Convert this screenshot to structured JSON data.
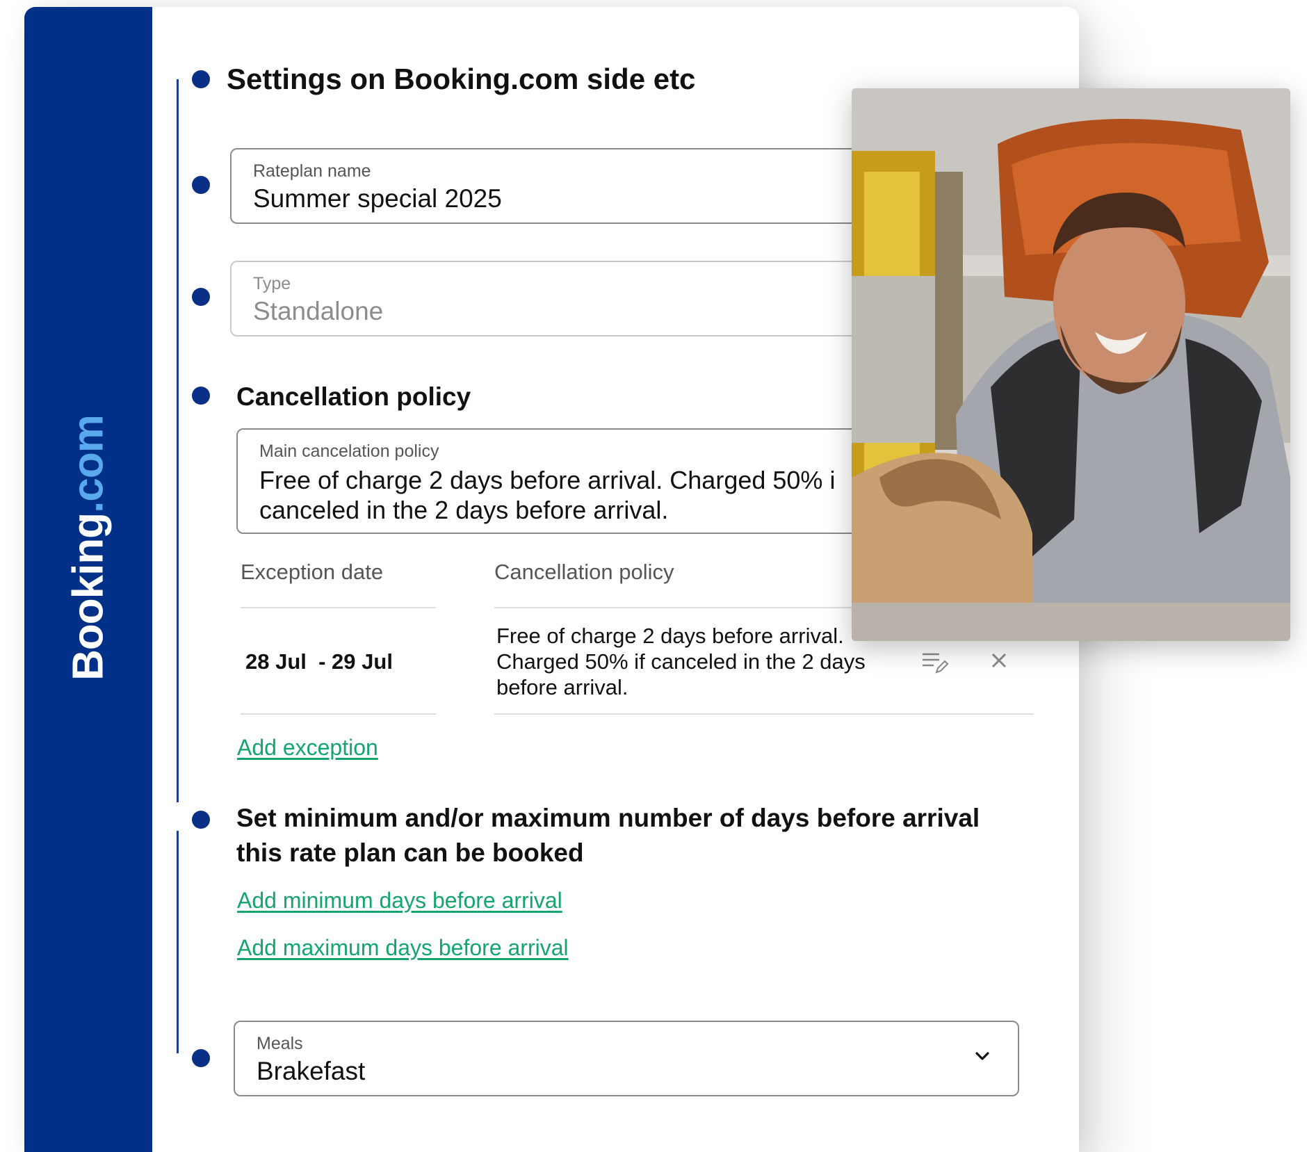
{
  "brand": {
    "part1": "Booking",
    "part2": ".com"
  },
  "section_title": "Settings on Booking.com side etc",
  "rateplan": {
    "label": "Rateplan name",
    "value": "Summer special 2025"
  },
  "type": {
    "label": "Type",
    "value": "Standalone"
  },
  "cancellation": {
    "heading": "Cancellation policy",
    "main_label": "Main cancelation policy",
    "main_line1": "Free of charge 2 days before arrival. Charged 50% i",
    "main_line2": "canceled in the 2 days before arrival.",
    "table": {
      "col_date": "Exception date",
      "col_policy": "Cancellation policy",
      "row": {
        "date": "28 Jul  - 29 Jul",
        "policy_line1": "Free of charge 2 days before arrival.",
        "policy_line2": "Charged 50% if canceled in the 2 days",
        "policy_line3": "before arrival."
      }
    },
    "add_exception": "Add exception"
  },
  "days_before": {
    "heading_line1": "Set minimum and/or maximum number of days before arrival",
    "heading_line2": "this rate plan can be booked",
    "add_min": "Add minimum days before arrival",
    "add_max": "Add maximum days before arrival"
  },
  "meals": {
    "label": "Meals",
    "value": "Brakefast"
  },
  "icons": [
    "edit-icon",
    "close-icon",
    "chevron-down-icon"
  ],
  "colors": {
    "sidebar": "#003087",
    "brand_dot_com": "#5aa9ec",
    "timeline": "#0a2f86",
    "link": "#13a56c"
  }
}
